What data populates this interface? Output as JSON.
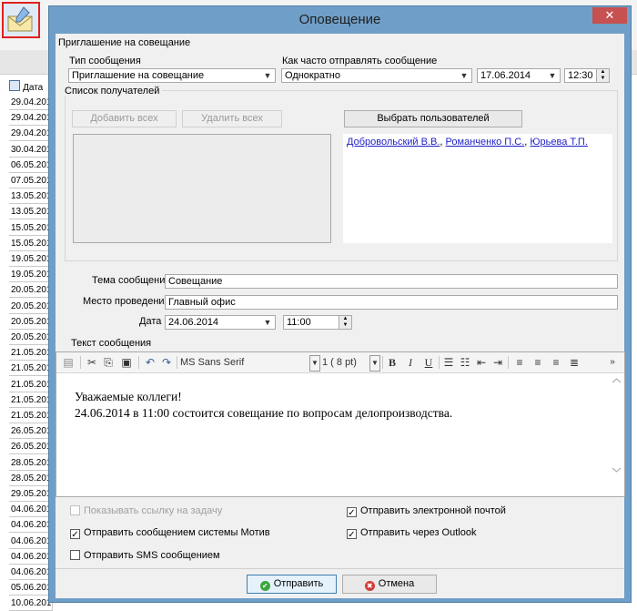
{
  "background": {
    "column_header": "Дата",
    "dates": [
      "29.04.201",
      "29.04.201",
      "29.04.201",
      "30.04.201",
      "06.05.201",
      "07.05.201",
      "13.05.201",
      "13.05.201",
      "15.05.201",
      "15.05.201",
      "19.05.201",
      "19.05.201",
      "20.05.201",
      "20.05.201",
      "20.05.201",
      "20.05.201",
      "21.05.201",
      "21.05.201",
      "21.05.201",
      "21.05.201",
      "21.05.201",
      "26.05.201",
      "26.05.201",
      "28.05.201",
      "28.05.201",
      "29.05.201",
      "04.06.201",
      "04.06.201",
      "04.06.201",
      "04.06.201",
      "04.06.201",
      "05.06.201",
      "10.06.201"
    ]
  },
  "dialog": {
    "title": "Оповещение",
    "close": "✕",
    "section": "Приглашение на совещание",
    "message_type_label": "Тип сообщения",
    "message_type_value": "Приглашение на совещание",
    "frequency_label": "Как часто отправлять сообщение",
    "frequency_value": "Однократно",
    "send_date": "17.06.2014",
    "send_time": "12:30",
    "recipients_label": "Список получателей",
    "add_all": "Добавить всех",
    "remove_all": "Удалить всех",
    "select_users": "Выбрать пользователей",
    "recipients": [
      "Добровольский В.В.",
      "Романченко П.С.",
      "Юрьева Т.П."
    ],
    "subject_label": "Тема сообщения",
    "subject_value": "Совещание",
    "place_label": "Место проведения",
    "place_value": "Главный офис",
    "date_label": "Дата",
    "date_value": "24.06.2014",
    "time_value": "11:00",
    "text_label": "Текст сообщения",
    "toolbar": {
      "font": "MS Sans Serif",
      "size": "1 ( 8 pt)"
    },
    "message_lines": [
      "Уважаемые коллеги!",
      "24.06.2014 в 11:00 состоится совещание по вопросам делопроизводства."
    ],
    "options": {
      "show_link": "Показывать ссылку на задачу",
      "send_motiv": "Отправить сообщением системы Мотив",
      "send_sms": "Отправить SMS сообщением",
      "send_email": "Отправить электронной почтой",
      "send_outlook": "Отправить через Outlook"
    },
    "send_button": "Отправить",
    "cancel_button": "Отмена"
  }
}
